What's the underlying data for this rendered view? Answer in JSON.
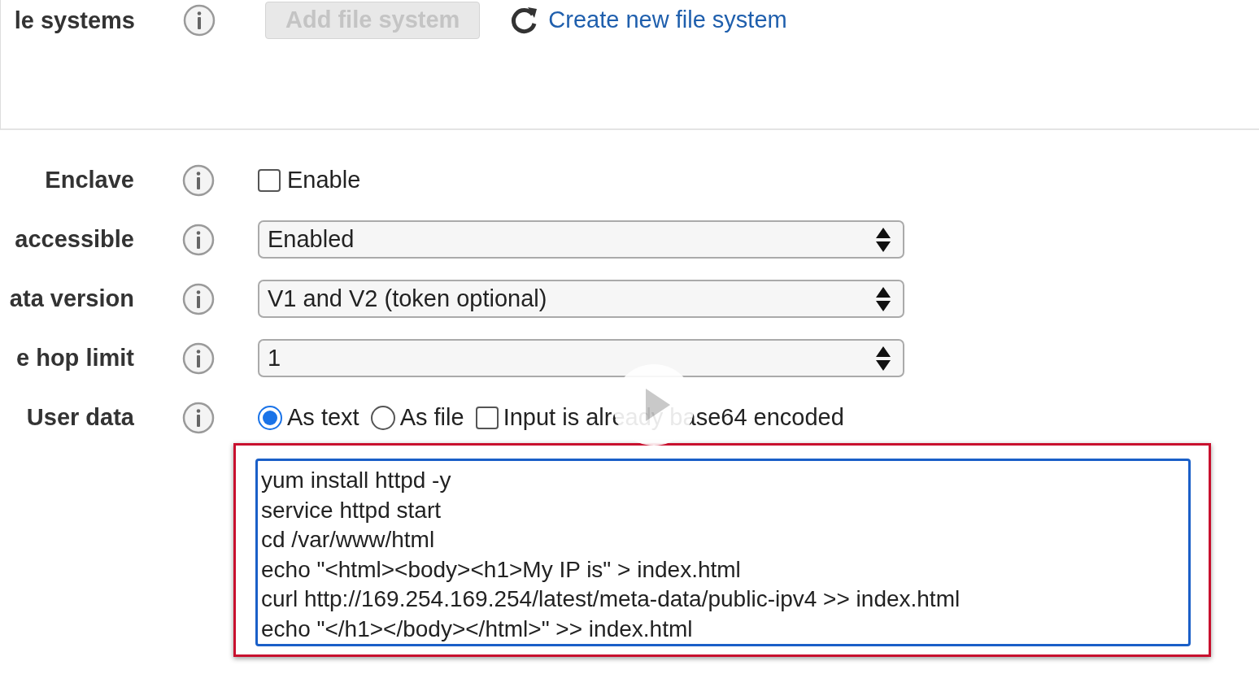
{
  "top_row": {
    "label": "le systems",
    "add_button": {
      "label": "Add file system",
      "disabled": true
    },
    "create_link": "Create new file system"
  },
  "fields": [
    {
      "kind": "checkbox",
      "label": "Enclave",
      "option": "Enable",
      "checked": false
    },
    {
      "kind": "select",
      "label": "accessible",
      "value": "Enabled"
    },
    {
      "kind": "select",
      "label": "ata version",
      "value": "V1 and V2 (token optional)"
    },
    {
      "kind": "select",
      "label": "e hop limit",
      "value": "1"
    },
    {
      "kind": "user_data",
      "label": "User data",
      "options": [
        {
          "label": "As text",
          "selected": true
        },
        {
          "label": "As file",
          "selected": false
        }
      ],
      "base64": {
        "label": "Input is already base64 encoded",
        "checked": false
      }
    }
  ],
  "user_data_text": {
    "lines": [
      "yum install httpd -y",
      "service httpd start",
      "cd /var/www/html",
      "echo \"<html><body><h1>My IP is\" > index.html",
      "curl http://169.254.169.254/latest/meta-data/public-ipv4 >> index.html",
      "echo \"</h1></body></html>\" >> index.html"
    ]
  }
}
